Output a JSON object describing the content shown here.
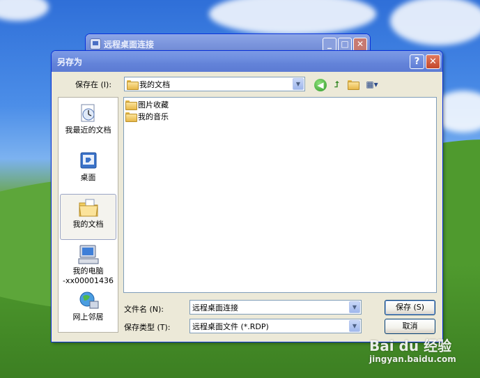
{
  "background_window": {
    "title": "远程桌面连接",
    "minimize": "_",
    "maximize": "□",
    "close": "✕"
  },
  "dialog": {
    "title": "另存为",
    "help": "?",
    "close": "✕",
    "save_in_label": "保存在 (I):",
    "save_in_value": "我的文档",
    "places": [
      {
        "label": "我最近的文档",
        "icon": "recent-documents-icon"
      },
      {
        "label": "桌面",
        "icon": "desktop-icon"
      },
      {
        "label": "我的文档",
        "icon": "my-documents-icon"
      },
      {
        "label": "我的电脑",
        "label2": "-xx00001436",
        "icon": "my-computer-icon"
      },
      {
        "label": "网上邻居",
        "icon": "network-places-icon"
      }
    ],
    "files": [
      {
        "name": "图片收藏",
        "icon": "folder-icon"
      },
      {
        "name": "我的音乐",
        "icon": "folder-icon"
      }
    ],
    "filename_label": "文件名 (N):",
    "filename_value": "远程桌面连接",
    "filetype_label": "保存类型 (T):",
    "filetype_value": "远程桌面文件 (*.RDP)",
    "save_button": "保存 (S)",
    "cancel_button": "取消"
  },
  "watermark": {
    "brand": "Bai du 经验",
    "url": "jingyan.baidu.com"
  }
}
